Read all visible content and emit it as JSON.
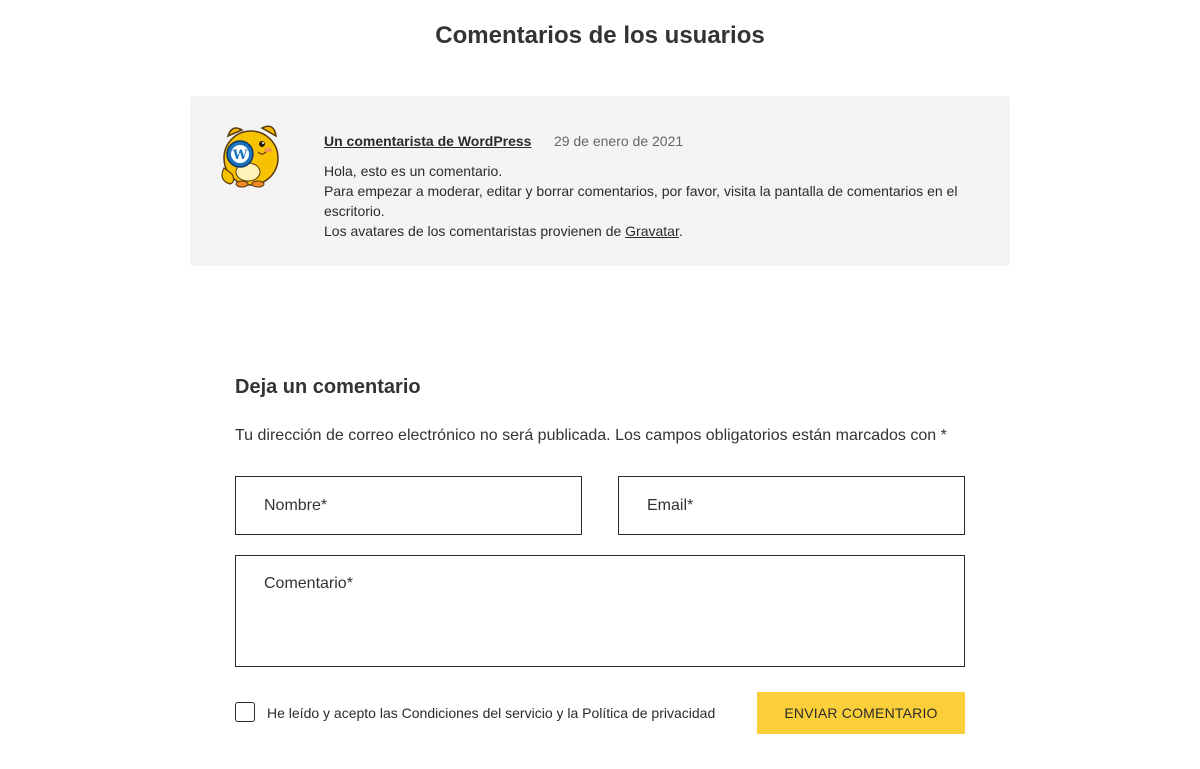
{
  "comments_section": {
    "title": "Comentarios de los usuarios",
    "comments": [
      {
        "author": "Un comentarista de WordPress",
        "date": "29 de enero de 2021",
        "avatar_icon": "wapuu-avatar-icon",
        "lines": {
          "line1": "Hola, esto es un comentario.",
          "line2": "Para empezar a moderar, editar y borrar comentarios, por favor, visita la pantalla de comentarios en el escritorio.",
          "line3_prefix": "Los avatares de los comentaristas provienen de ",
          "line3_link": "Gravatar",
          "line3_suffix": "."
        }
      }
    ]
  },
  "reply_form": {
    "title": "Deja un comentario",
    "notes": "Tu dirección de correo electrónico no será publicada. Los campos obligatorios están marcados con *",
    "name_placeholder": "Nombre*",
    "email_placeholder": "Email*",
    "comment_placeholder": "Comentario*",
    "name_value": "",
    "email_value": "",
    "comment_value": "",
    "consent_label": "He leído y acepto las Condiciones del servicio y la Política de privacidad",
    "consent_checked": false,
    "submit_label": "ENVIAR COMENTARIO"
  },
  "colors": {
    "accent": "#fbcf3a",
    "card_background": "#f4f4f4",
    "text": "#2b2b2b"
  }
}
